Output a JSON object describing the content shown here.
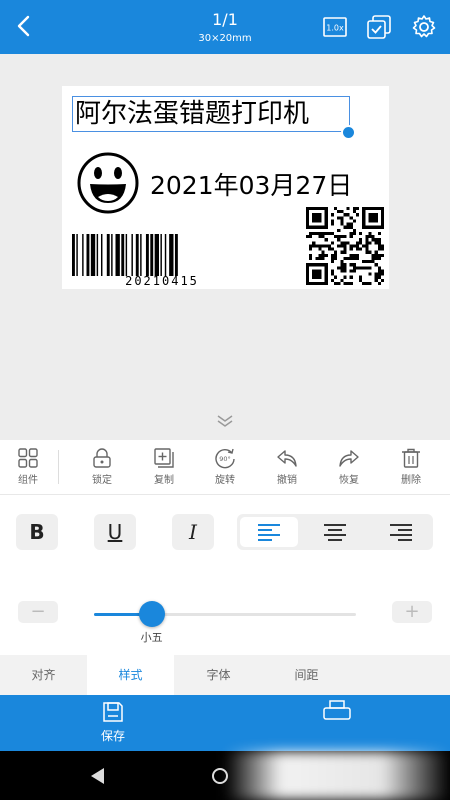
{
  "header": {
    "page_indicator": "1/1",
    "label_size": "30×20mm",
    "zoom_label": "1.0x"
  },
  "label": {
    "text": "阿尔法蛋错题打印机",
    "date": "2021年03月27日",
    "barcode_value": "20210415"
  },
  "toolbar": {
    "items": [
      {
        "label": "组件",
        "icon": "grid-icon"
      },
      {
        "label": "锁定",
        "icon": "lock-icon"
      },
      {
        "label": "复制",
        "icon": "copy-icon"
      },
      {
        "label": "旋转",
        "icon": "rotate-icon",
        "icon_text": "90°"
      },
      {
        "label": "撤销",
        "icon": "undo-icon"
      },
      {
        "label": "恢复",
        "icon": "redo-icon"
      },
      {
        "label": "删除",
        "icon": "trash-icon"
      }
    ]
  },
  "style": {
    "bold": "B",
    "underline": "U",
    "italic": "I",
    "alignment_selected": "left",
    "font_size_label": "小五",
    "font_size_level": 0.22,
    "minus": "−",
    "plus": "+"
  },
  "tabs": [
    {
      "label": "对齐",
      "active": false
    },
    {
      "label": "样式",
      "active": true
    },
    {
      "label": "字体",
      "active": false
    },
    {
      "label": "间距",
      "active": false
    }
  ],
  "bottom": {
    "save_label": "保存"
  },
  "colors": {
    "primary": "#1a87dc"
  }
}
